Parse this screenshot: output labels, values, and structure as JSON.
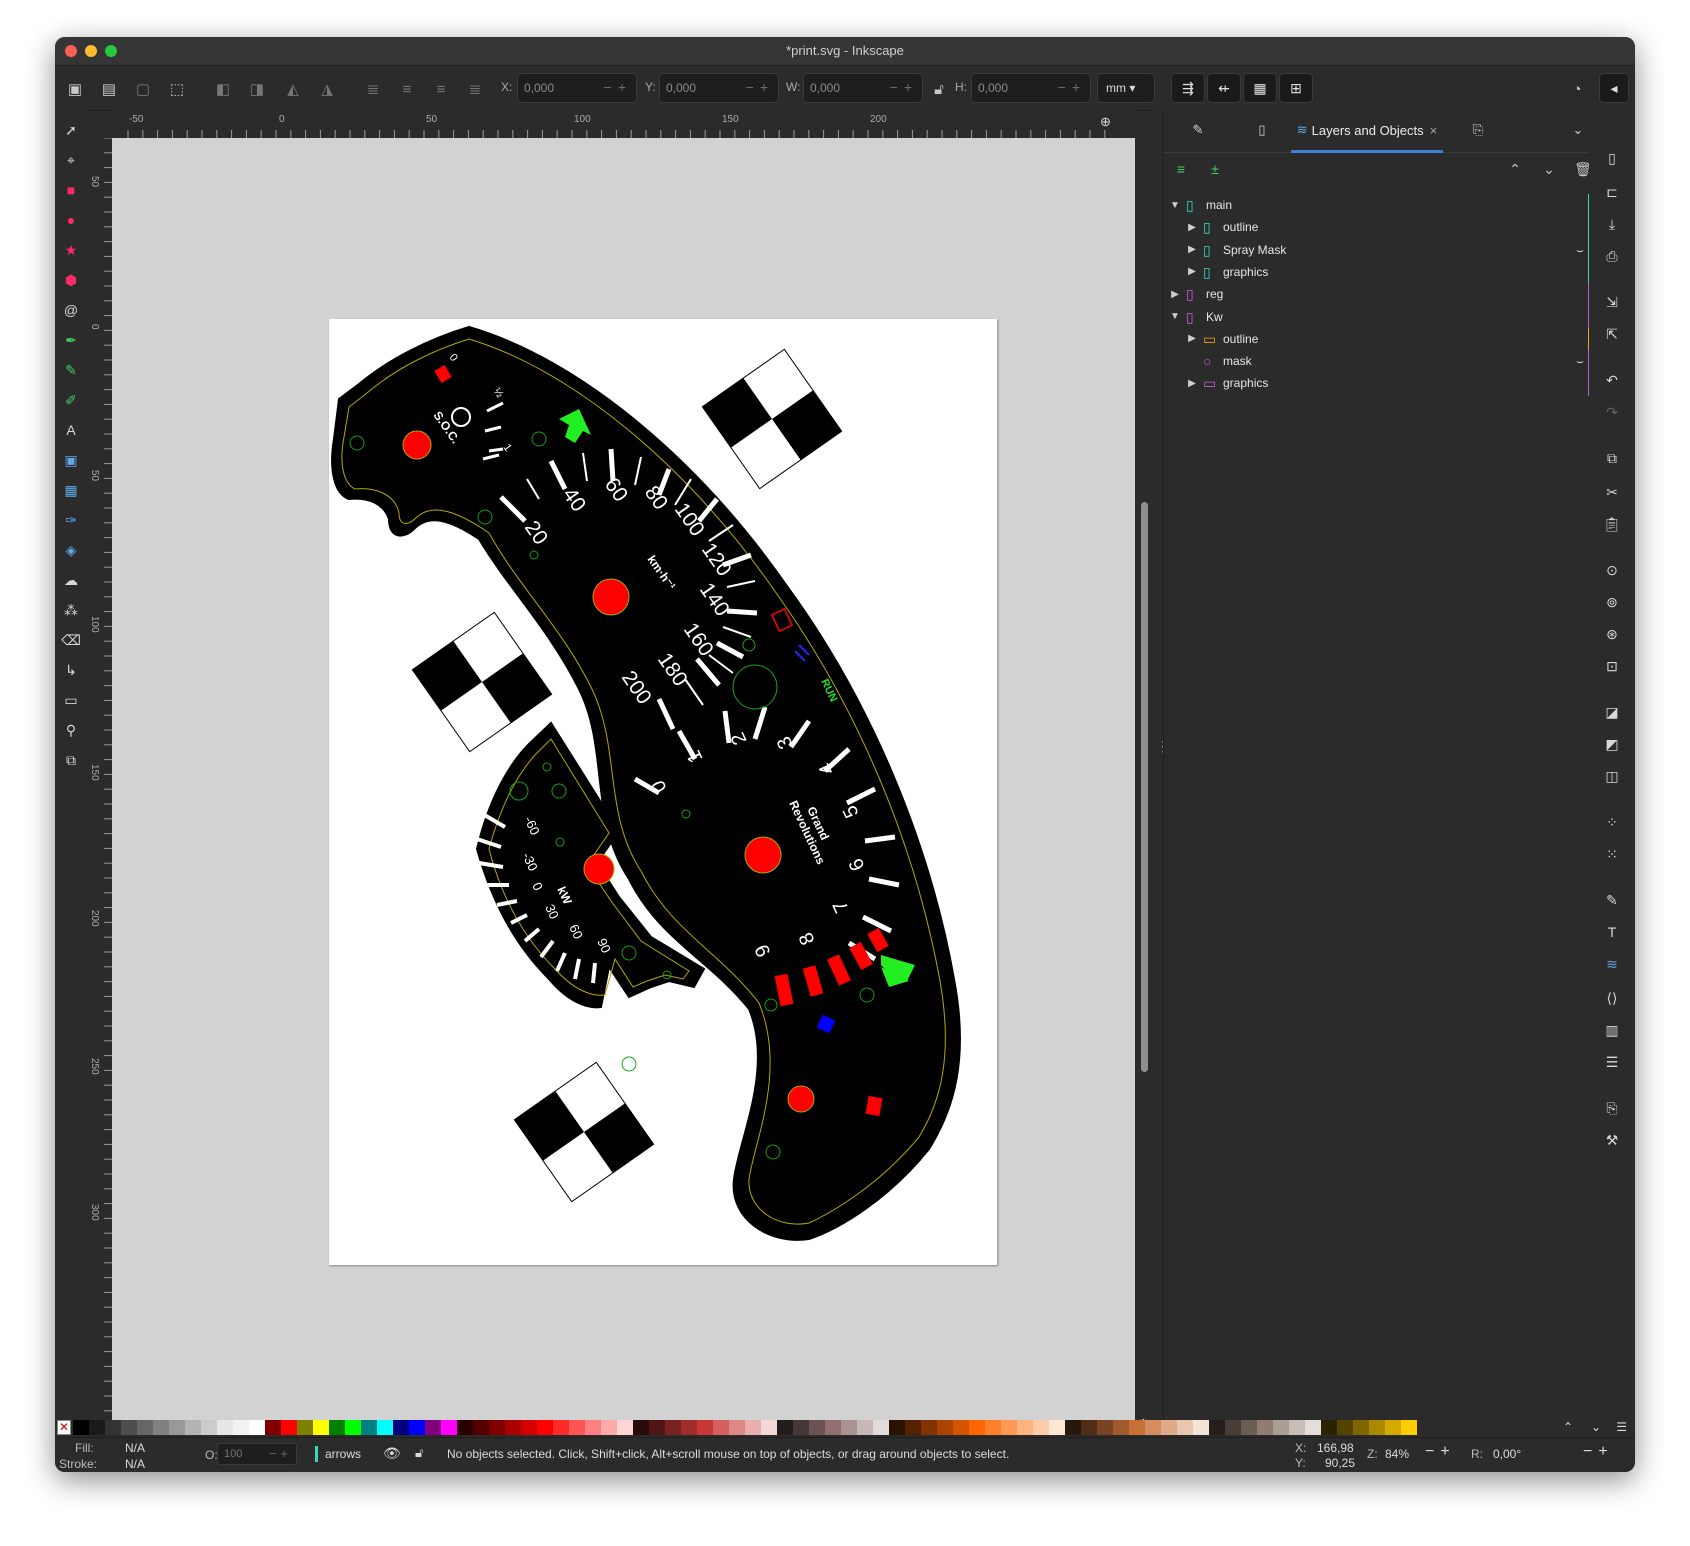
{
  "window": {
    "title": "*print.svg - Inkscape"
  },
  "toolbar": {
    "x_label": "X:",
    "x_value": "0,000",
    "y_label": "Y:",
    "y_value": "0,000",
    "w_label": "W:",
    "w_value": "0,000",
    "h_label": "H:",
    "h_value": "0,000",
    "unit": "mm"
  },
  "ruler": {
    "h_marks": [
      "-50",
      "0",
      "50",
      "100",
      "150",
      "200"
    ],
    "v_marks": [
      "50",
      "0",
      "50",
      "100",
      "150",
      "200",
      "250",
      "300"
    ]
  },
  "drawing": {
    "speed_ticks": [
      "20",
      "40",
      "60",
      "80",
      "100",
      "120",
      "140",
      "160",
      "180",
      "200"
    ],
    "speed_unit": "km·h⁻¹",
    "rpm_ticks": [
      "0",
      "1",
      "2",
      "3",
      "4",
      "5",
      "6",
      "7",
      "8",
      "9"
    ],
    "rpm_label_1": "Grand",
    "rpm_label_2": "Revolutions",
    "soc_label": "S.O.C.",
    "soc_ticks": [
      "0",
      "½",
      "1"
    ],
    "run_label": "RUN",
    "kw_ticks": [
      "-60",
      "-30",
      "0",
      "30",
      "60",
      "90"
    ],
    "kw_label": "kW"
  },
  "dock": {
    "tabs": [
      {
        "label": "",
        "icon": "fill-stroke-icon"
      },
      {
        "label": "",
        "icon": "document-properties-icon"
      },
      {
        "label": "Layers and Objects",
        "icon": "layers-icon"
      },
      {
        "label": "",
        "icon": "export-icon"
      }
    ],
    "tree": [
      {
        "label": "main",
        "level": 0,
        "expanded": true,
        "color": "#3ad6c0",
        "icon": "layer-icon",
        "eye": false
      },
      {
        "label": "outline",
        "level": 1,
        "expanded": false,
        "color": "#3ad6c0",
        "icon": "layer-icon",
        "eye": false
      },
      {
        "label": "Spray Mask",
        "level": 1,
        "expanded": false,
        "color": "#3ad6c0",
        "icon": "layer-icon",
        "eye": true
      },
      {
        "label": "graphics",
        "level": 1,
        "expanded": false,
        "color": "#3ad6c0",
        "icon": "layer-icon",
        "eye": false
      },
      {
        "label": "reg",
        "level": 0,
        "expanded": false,
        "color": "#c060d0",
        "icon": "layer-icon",
        "eye": false
      },
      {
        "label": "Kw",
        "level": 0,
        "expanded": true,
        "color": "#c060d0",
        "icon": "layer-icon",
        "eye": false
      },
      {
        "label": "outline",
        "level": 1,
        "expanded": false,
        "color": "#f0a020",
        "icon": "group-icon",
        "eye": false
      },
      {
        "label": "mask",
        "level": 1,
        "expanded": null,
        "color": "#c060d0",
        "icon": "circle-icon",
        "eye": true
      },
      {
        "label": "graphics",
        "level": 1,
        "expanded": false,
        "color": "#c060d0",
        "icon": "group-icon",
        "eye": false
      }
    ]
  },
  "palette": {
    "colors": [
      "#000000",
      "#1a1a1a",
      "#333333",
      "#4d4d4d",
      "#666666",
      "#808080",
      "#999999",
      "#b3b3b3",
      "#cccccc",
      "#e6e6e6",
      "#f2f2f2",
      "#ffffff",
      "#800000",
      "#ff0000",
      "#808000",
      "#ffff00",
      "#008000",
      "#00ff00",
      "#008080",
      "#00ffff",
      "#000080",
      "#0000ff",
      "#800080",
      "#ff00ff",
      "#2b0000",
      "#550000",
      "#800000",
      "#aa0000",
      "#d40000",
      "#ff0000",
      "#ff2a2a",
      "#ff5555",
      "#ff8080",
      "#ffaaaa",
      "#ffd5d5",
      "#280b0b",
      "#501616",
      "#782121",
      "#a02c2c",
      "#c83737",
      "#d35f5f",
      "#de8787",
      "#e9afaf",
      "#f4d7d7",
      "#241c1c",
      "#483737",
      "#6c5353",
      "#916f6f",
      "#ac9393",
      "#c8b7b7",
      "#e3dbdb",
      "#2b1100",
      "#552200",
      "#803300",
      "#aa4400",
      "#d45500",
      "#ff6600",
      "#ff7f2a",
      "#ff9955",
      "#ffb380",
      "#ffccaa",
      "#ffe6d5",
      "#28170b",
      "#502d16",
      "#784421",
      "#a05a2c",
      "#c87137",
      "#d38d5f",
      "#deaa87",
      "#e9c6af",
      "#f4e3d7",
      "#241f1c",
      "#483e37",
      "#6c5d53",
      "#917c6f",
      "#ac9d93",
      "#c8beb7",
      "#e3dedb",
      "#2b2200",
      "#554400",
      "#806600",
      "#aa8800",
      "#d4aa00",
      "#ffcc00"
    ]
  },
  "status": {
    "fill_label": "Fill:",
    "fill_value": "N/A",
    "stroke_label": "Stroke:",
    "stroke_value": "N/A",
    "opacity_label": "O:",
    "opacity_value": "100",
    "layer": "arrows",
    "message": "No objects selected. Click, Shift+click, Alt+scroll mouse on top of objects, or drag around objects to select.",
    "x_label": "X:",
    "x_value": "166,98",
    "y_label": "Y:",
    "y_value": "90,25",
    "zoom_label": "Z:",
    "zoom_value": "84%",
    "rotation_label": "R:",
    "rotation_value": "0,00°"
  }
}
